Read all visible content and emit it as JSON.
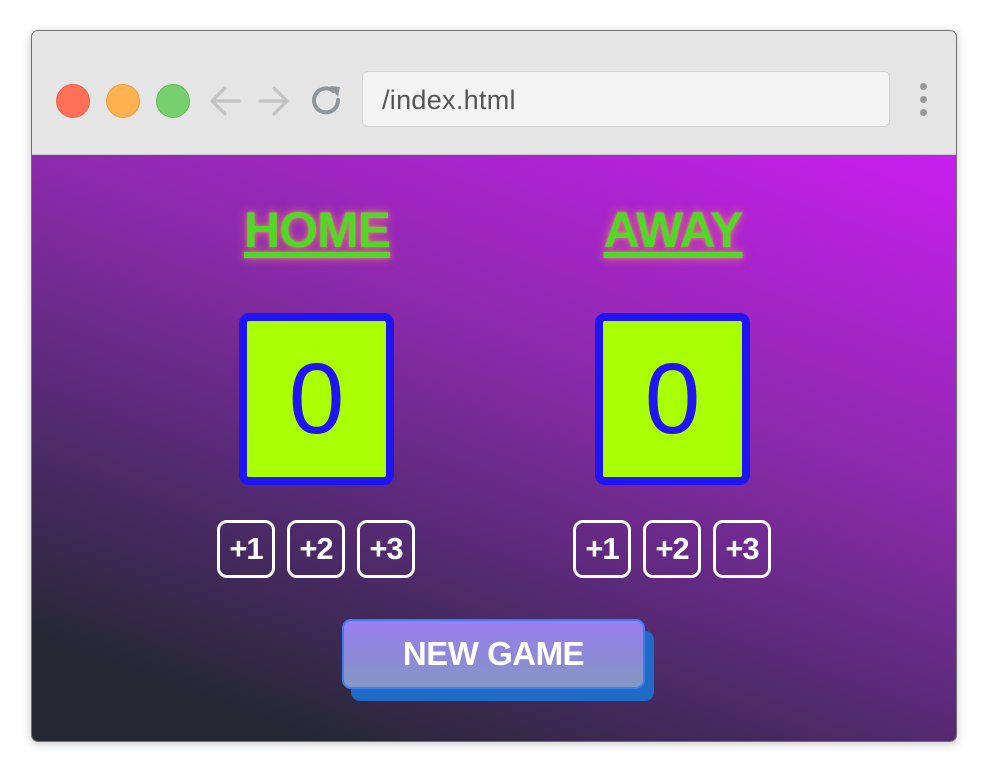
{
  "browser": {
    "url": "/index.html",
    "controls": {
      "close": "close-button",
      "minimize": "minimize-button",
      "maximize": "maximize-button",
      "back_icon": "arrow-left-icon",
      "forward_icon": "arrow-right-icon",
      "reload_icon": "reload-icon",
      "menu_icon": "kebab-menu-icon"
    }
  },
  "scoreboard": {
    "home": {
      "title": "HOME",
      "score": "0",
      "buttons": [
        "+1",
        "+2",
        "+3"
      ]
    },
    "away": {
      "title": "AWAY",
      "score": "0",
      "buttons": [
        "+1",
        "+2",
        "+3"
      ]
    },
    "new_game_label": "NEW GAME"
  },
  "colors": {
    "title_green": "#51d827",
    "score_bg": "#a9ff03",
    "score_border": "#1f14f2",
    "background_gradient": [
      "#232832",
      "#5b2a7a",
      "#8b2aab",
      "#c91ef0"
    ],
    "button_outline": "#ffffff",
    "new_game_bg": "#8e88d8",
    "new_game_shadow": "#1f6bc5"
  }
}
